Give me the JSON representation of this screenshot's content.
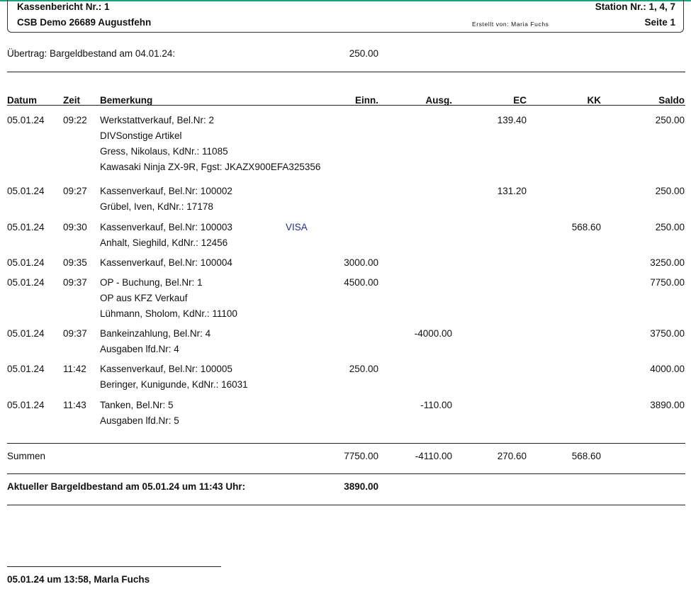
{
  "header": {
    "report_title": "Kassenbericht Nr.: 1",
    "station": "Station Nr.: 1, 4, 7",
    "company": "CSB Demo 26689 Augustfehn",
    "created_by": "Erstellt von: Maria Fuchs",
    "page": "Seite 1"
  },
  "carryover": {
    "label": "Übertrag: Bargeldbestand am 04.01.24:",
    "value": "250.00"
  },
  "columns": {
    "date": "Datum",
    "time": "Zeit",
    "remark": "Bemerkung",
    "income": "Einn.",
    "expense": "Ausg.",
    "ec": "EC",
    "kk": "KK",
    "balance": "Saldo"
  },
  "rows": [
    {
      "date": "05.01.24",
      "time": "09:22",
      "lines": [
        "Werkstattverkauf, Bel.Nr: 2",
        "DIVSonstige Artikel",
        "Gress, Nikolaus, KdNr.: 11085",
        "Kawasaki Ninja ZX-9R, Fgst: JKAZX900EFA325356"
      ],
      "tag": "",
      "income": "",
      "expense": "",
      "ec": "139.40",
      "kk": "",
      "balance": "250.00"
    },
    {
      "date": "05.01.24",
      "time": "09:27",
      "lines": [
        "Kassenverkauf, Bel.Nr: 100002",
        "Grübel, Iven, KdNr.: 17178"
      ],
      "tag": "",
      "income": "",
      "expense": "",
      "ec": "131.20",
      "kk": "",
      "balance": "250.00"
    },
    {
      "date": "05.01.24",
      "time": "09:30",
      "lines": [
        "Kassenverkauf, Bel.Nr: 100003",
        "Anhalt, Sieghild, KdNr.: 12456"
      ],
      "tag": "VISA",
      "income": "",
      "expense": "",
      "ec": "",
      "kk": "568.60",
      "balance": "250.00"
    },
    {
      "date": "05.01.24",
      "time": "09:35",
      "lines": [
        "Kassenverkauf, Bel.Nr: 100004"
      ],
      "tag": "",
      "income": "3000.00",
      "expense": "",
      "ec": "",
      "kk": "",
      "balance": "3250.00"
    },
    {
      "date": "05.01.24",
      "time": "09:37",
      "lines": [
        "OP - Buchung, Bel.Nr: 1",
        "OP aus KFZ Verkauf",
        "Lühmann, Sholom, KdNr.: 11100"
      ],
      "tag": "",
      "income": "4500.00",
      "expense": "",
      "ec": "",
      "kk": "",
      "balance": "7750.00"
    },
    {
      "date": "05.01.24",
      "time": "09:37",
      "lines": [
        "Bankeinzahlung, Bel.Nr: 4",
        "Ausgaben lfd.Nr: 4"
      ],
      "tag": "",
      "income": "",
      "expense": "-4000.00",
      "ec": "",
      "kk": "",
      "balance": "3750.00"
    },
    {
      "date": "05.01.24",
      "time": "11:42",
      "lines": [
        "Kassenverkauf, Bel.Nr: 100005",
        "Beringer, Kunigunde, KdNr.: 16031"
      ],
      "tag": "",
      "income": "250.00",
      "expense": "",
      "ec": "",
      "kk": "",
      "balance": "4000.00"
    },
    {
      "date": "05.01.24",
      "time": "11:43",
      "lines": [
        "Tanken, Bel.Nr: 5",
        "Ausgaben lfd.Nr: 5"
      ],
      "tag": "",
      "income": "",
      "expense": "-110.00",
      "ec": "",
      "kk": "",
      "balance": "3890.00"
    }
  ],
  "totals": {
    "label": "Summen",
    "income": "7750.00",
    "expense": "-4110.00",
    "ec": "270.60",
    "kk": "568.60"
  },
  "current": {
    "label": "Aktueller Bargeldbestand am 05.01.24 um 11:43 Uhr:",
    "value": "3890.00"
  },
  "signature": "05.01.24 um 13:58, Marla Fuchs"
}
